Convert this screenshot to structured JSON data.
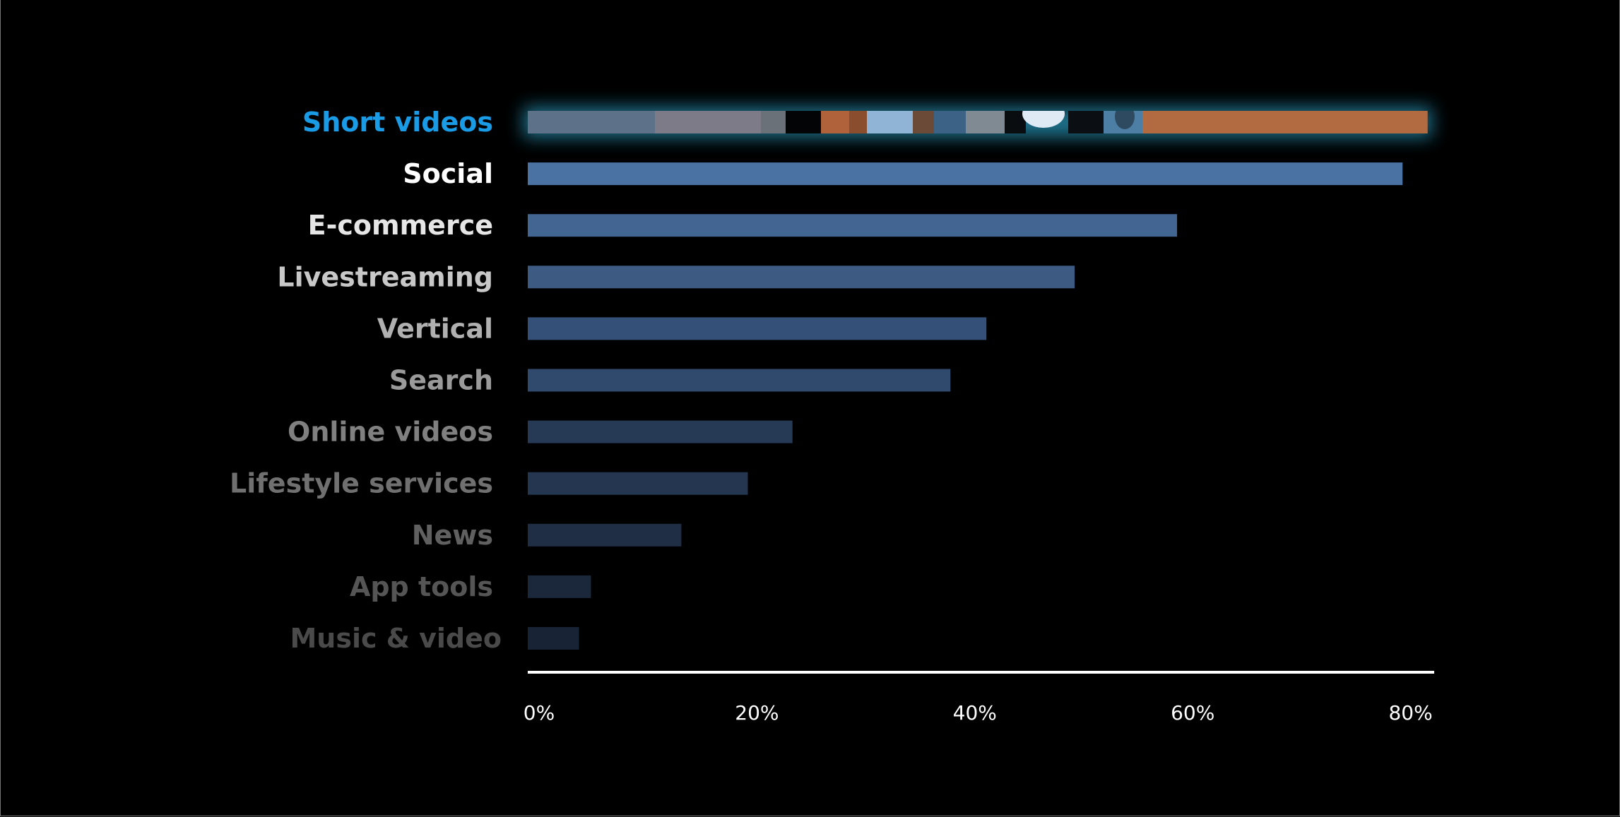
{
  "chart_data": {
    "type": "bar",
    "orientation": "horizontal",
    "title": "",
    "xlabel": "",
    "ylabel": "",
    "xlim": [
      0,
      80
    ],
    "grid": false,
    "legend": "none",
    "x_ticks": [
      "0%",
      "20%",
      "40%",
      "60%",
      "80%"
    ],
    "x_tick_values": [
      0,
      20,
      40,
      60,
      80
    ],
    "categories": [
      "Short videos",
      "Social",
      "E-commerce",
      "Livestreaming",
      "Vertical",
      "Search",
      "Online videos",
      "Lifestyle services",
      "News",
      "App tools",
      "Music & video"
    ],
    "values": [
      82.6,
      80.3,
      59.6,
      50.2,
      42.1,
      38.8,
      24.3,
      20.2,
      14.1,
      5.8,
      4.7
    ],
    "unit": "%",
    "highlighted_category": "Short videos",
    "label_colors": [
      "#1a9be6",
      "#ffffff",
      "#e6e6e6",
      "#c8c8c8",
      "#b0b0b0",
      "#9a9a9a",
      "#808080",
      "#707070",
      "#606060",
      "#555555",
      "#4a4a4a"
    ],
    "bar_colors": [
      "image-fill",
      "#4a72a3",
      "#426592",
      "#3c5a82",
      "#355078",
      "#304a6e",
      "#263a56",
      "#243650",
      "#1f2e45",
      "#1b283c",
      "#182436"
    ],
    "highlight_glow_color": "#1a6e88"
  }
}
